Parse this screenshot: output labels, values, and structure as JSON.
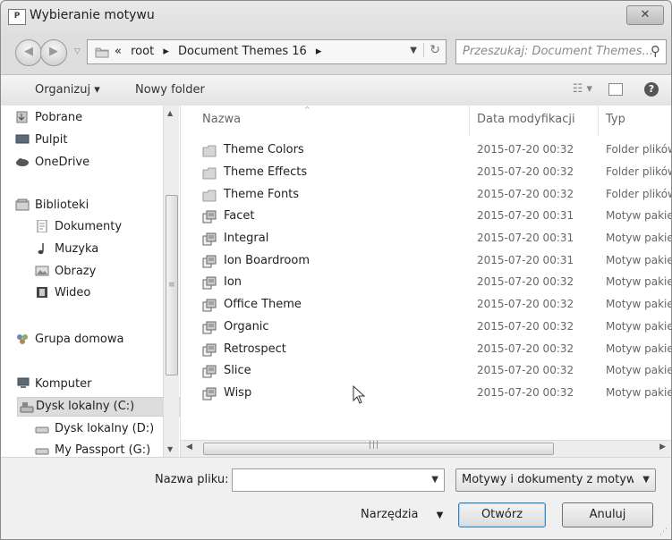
{
  "window": {
    "title": "Wybieranie motywu",
    "close_label": "✕"
  },
  "nav": {
    "breadcrumb": [
      "«",
      "root",
      "▸",
      "Document Themes 16",
      "▸"
    ],
    "search_placeholder": "Przeszukaj: Document Themes..."
  },
  "toolbar": {
    "organize": "Organizuj ▾",
    "new_folder": "Nowy folder"
  },
  "sidebar": {
    "items": [
      {
        "label": "Pobrane",
        "icon": "download-folder-icon"
      },
      {
        "label": "Pulpit",
        "icon": "desktop-icon"
      },
      {
        "label": "OneDrive",
        "icon": "cloud-icon"
      },
      {
        "label": "Biblioteki",
        "icon": "libraries-icon"
      },
      {
        "label": "Dokumenty",
        "icon": "documents-icon"
      },
      {
        "label": "Muzyka",
        "icon": "music-icon"
      },
      {
        "label": "Obrazy",
        "icon": "pictures-icon"
      },
      {
        "label": "Wideo",
        "icon": "video-icon"
      },
      {
        "label": "Grupa domowa",
        "icon": "homegroup-icon"
      },
      {
        "label": "Komputer",
        "icon": "computer-icon"
      },
      {
        "label": "Dysk lokalny (C:)",
        "icon": "drive-icon",
        "selected": true
      },
      {
        "label": "Dysk lokalny (D:)",
        "icon": "drive-icon"
      },
      {
        "label": "My Passport (G:)",
        "icon": "drive-icon"
      }
    ]
  },
  "columns": {
    "name": "Nazwa",
    "date": "Data modyfikacji",
    "type": "Typ"
  },
  "files": [
    {
      "name": "Theme Colors",
      "date": "2015-07-20 00:32",
      "type": "Folder plików",
      "kind": "folder"
    },
    {
      "name": "Theme Effects",
      "date": "2015-07-20 00:32",
      "type": "Folder plików",
      "kind": "folder"
    },
    {
      "name": "Theme Fonts",
      "date": "2015-07-20 00:32",
      "type": "Folder plików",
      "kind": "folder"
    },
    {
      "name": "Facet",
      "date": "2015-07-20 00:31",
      "type": "Motyw pakietu Office",
      "kind": "theme"
    },
    {
      "name": "Integral",
      "date": "2015-07-20 00:31",
      "type": "Motyw pakietu Office",
      "kind": "theme"
    },
    {
      "name": "Ion Boardroom",
      "date": "2015-07-20 00:31",
      "type": "Motyw pakietu Office",
      "kind": "theme"
    },
    {
      "name": "Ion",
      "date": "2015-07-20 00:32",
      "type": "Motyw pakietu Office",
      "kind": "theme"
    },
    {
      "name": "Office Theme",
      "date": "2015-07-20 00:32",
      "type": "Motyw pakietu Office",
      "kind": "theme"
    },
    {
      "name": "Organic",
      "date": "2015-07-20 00:32",
      "type": "Motyw pakietu Office",
      "kind": "theme"
    },
    {
      "name": "Retrospect",
      "date": "2015-07-20 00:32",
      "type": "Motyw pakietu Office",
      "kind": "theme"
    },
    {
      "name": "Slice",
      "date": "2015-07-20 00:32",
      "type": "Motyw pakietu Office",
      "kind": "theme"
    },
    {
      "name": "Wisp",
      "date": "2015-07-20 00:32",
      "type": "Motyw pakietu Office",
      "kind": "theme"
    }
  ],
  "bottom": {
    "filename_label": "Nazwa pliku:",
    "filename_value": "",
    "filetype_value": "Motywy i dokumenty z motywami",
    "tools_label": "Narzędzia",
    "open_button": "Otwórz",
    "cancel_button": "Anuluj"
  }
}
